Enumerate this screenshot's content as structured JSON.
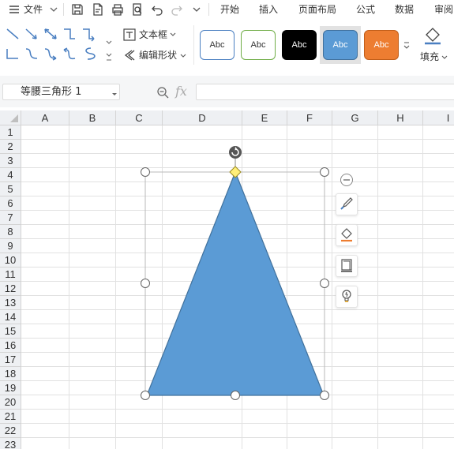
{
  "menubar": {
    "file_label": "文件",
    "tabs": [
      "开始",
      "插入",
      "页面布局",
      "公式",
      "数据",
      "审阅"
    ]
  },
  "ribbon": {
    "text_box_label": "文本框",
    "edit_shape_label": "编辑形状",
    "style_tiles": [
      {
        "label": "Abc",
        "fill": "#ffffff",
        "border": "#4a7fc1",
        "text_color": "#333333"
      },
      {
        "label": "Abc",
        "fill": "#ffffff",
        "border": "#70ad47",
        "text_color": "#333333"
      },
      {
        "label": "Abc",
        "fill": "#000000",
        "border": "#000000",
        "text_color": "#ffffff"
      },
      {
        "label": "Abc",
        "fill": "#5b9bd5",
        "border": "#41719c",
        "text_color": "#ffffff"
      },
      {
        "label": "Abc",
        "fill": "#ed7d31",
        "border": "#c05d19",
        "text_color": "#ffffff"
      }
    ],
    "fill_label": "填充"
  },
  "formula_bar": {
    "name_box_value": "等腰三角形 1",
    "fx_label": "fx",
    "formula_value": ""
  },
  "sheet": {
    "columns": [
      "A",
      "B",
      "C",
      "D",
      "E",
      "F",
      "G",
      "H",
      "I"
    ],
    "rows": [
      "1",
      "2",
      "3",
      "4",
      "5",
      "6",
      "7",
      "8",
      "9",
      "10",
      "11",
      "12",
      "13",
      "14",
      "15",
      "16",
      "17",
      "18",
      "19",
      "20",
      "21",
      "22",
      "23"
    ]
  },
  "shape": {
    "type": "isosceles-triangle",
    "fill_color": "#5b9bd5",
    "outline_color": "#41719c"
  },
  "colors": {
    "accent": "#5b9bd5",
    "handle_yellow": "#ffef7a"
  }
}
